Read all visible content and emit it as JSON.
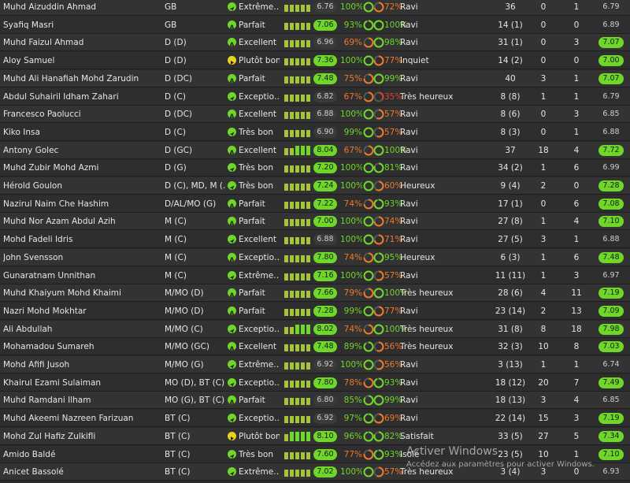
{
  "colors": {
    "good_green": "#6fd62a",
    "form_yellow": "#e6d21f",
    "ring_orange": "#f0782a",
    "ring_red": "#e04030",
    "muted_badge": "#3a3a3a"
  },
  "players": [
    {
      "name": "Muhd Aizuddin Ahmad",
      "position": "GB",
      "icon": "send-icon",
      "form": "Extrême…",
      "form_bars": [
        3,
        3,
        3,
        3,
        3
      ],
      "rating": "6.76",
      "rating_highlight": false,
      "p1": "100%",
      "ring1": "green",
      "p2": "72%",
      "ring2": "orange",
      "morale": "Ravi",
      "apps": "36",
      "goals": "0",
      "assists": "1",
      "avg": "6.79",
      "avg_highlight": false
    },
    {
      "name": "Syafiq Masri",
      "position": "GB",
      "icon": "a-badge-icon",
      "form": "Parfait",
      "form_bars": [
        3,
        3,
        3,
        3,
        3
      ],
      "rating": "7.06",
      "rating_highlight": true,
      "p1": "93%",
      "ring1": "green",
      "p2": "100%",
      "ring2": "green",
      "morale": "Ravi",
      "apps": "14 (1)",
      "goals": "0",
      "assists": "0",
      "avg": "6.89",
      "avg_highlight": false
    },
    {
      "name": "Muhd Faizul Ahmad",
      "position": "D (D)",
      "icon": "a-badge-icon",
      "form": "Excellent",
      "form_bars": [
        3,
        3,
        3,
        3,
        3
      ],
      "rating": "6.96",
      "rating_highlight": false,
      "p1": "69%",
      "ring1": "orange",
      "p2": "98%",
      "ring2": "green",
      "morale": "Ravi",
      "apps": "31 (1)",
      "goals": "0",
      "assists": "3",
      "avg": "7.07",
      "avg_highlight": true
    },
    {
      "name": "Aloy Samuel",
      "position": "D (D)",
      "icon": "play-icon",
      "form": "Plutôt bon",
      "form_bars": [
        3,
        3,
        3,
        3,
        3
      ],
      "rating": "7.36",
      "rating_highlight": true,
      "p1": "100%",
      "ring1": "green",
      "p2": "77%",
      "ring2": "orange",
      "morale": "Inquiet",
      "apps": "14 (2)",
      "goals": "0",
      "assists": "0",
      "avg": "7.00",
      "avg_highlight": true
    },
    {
      "name": "Muhd Ali Hanafiah Mohd Zarudin",
      "position": "D (DC)",
      "icon": "a-badge-icon",
      "form": "Parfait",
      "form_bars": [
        3,
        3,
        3,
        3,
        3
      ],
      "rating": "7.48",
      "rating_highlight": true,
      "p1": "75%",
      "ring1": "orange",
      "p2": "99%",
      "ring2": "green",
      "morale": "Ravi",
      "apps": "40",
      "goals": "3",
      "assists": "1",
      "avg": "7.07",
      "avg_highlight": true
    },
    {
      "name": "Abdul Suhairil Idham Zahari",
      "position": "D (C)",
      "icon": "send-icon",
      "form": "Exceptio…",
      "form_bars": [
        3,
        3,
        3,
        3,
        3
      ],
      "rating": "6.82",
      "rating_highlight": false,
      "p1": "67%",
      "ring1": "orange",
      "p2": "35%",
      "ring2": "red",
      "morale": "Très heureux",
      "apps": "8 (8)",
      "goals": "1",
      "assists": "1",
      "avg": "6.79",
      "avg_highlight": false
    },
    {
      "name": "Francesco Paolucci",
      "position": "D (DC)",
      "icon": "a-badge-icon",
      "form": "Excellent",
      "form_bars": [
        3,
        3,
        3,
        3,
        3
      ],
      "rating": "6.88",
      "rating_highlight": false,
      "p1": "100%",
      "ring1": "green",
      "p2": "57%",
      "ring2": "orange",
      "morale": "Ravi",
      "apps": "8 (6)",
      "goals": "0",
      "assists": "3",
      "avg": "6.85",
      "avg_highlight": false
    },
    {
      "name": "Kiko Insa",
      "position": "D (C)",
      "icon": "send-icon",
      "form": "Très bon",
      "form_bars": [
        3,
        3,
        3,
        3,
        3
      ],
      "rating": "6.90",
      "rating_highlight": false,
      "p1": "99%",
      "ring1": "green",
      "p2": "57%",
      "ring2": "orange",
      "morale": "Ravi",
      "apps": "8 (3)",
      "goals": "0",
      "assists": "1",
      "avg": "6.88",
      "avg_highlight": false
    },
    {
      "name": "Antony Golec",
      "position": "D (GC)",
      "icon": "a-badge-icon",
      "form": "Excellent",
      "form_bars": [
        3,
        3,
        4,
        4,
        4
      ],
      "rating": "8.04",
      "rating_highlight": true,
      "p1": "67%",
      "ring1": "orange",
      "p2": "100%",
      "ring2": "green",
      "morale": "Ravi",
      "apps": "37",
      "goals": "18",
      "assists": "4",
      "avg": "7.72",
      "avg_highlight": true
    },
    {
      "name": "Muhd Zubir Mohd Azmi",
      "position": "D (G)",
      "icon": "send-icon",
      "form": "Très bon",
      "form_bars": [
        3,
        3,
        3,
        3,
        3
      ],
      "rating": "7.20",
      "rating_highlight": true,
      "p1": "100%",
      "ring1": "green",
      "p2": "81%",
      "ring2": "green",
      "morale": "Ravi",
      "apps": "34 (2)",
      "goals": "1",
      "assists": "6",
      "avg": "6.99",
      "avg_highlight": false
    },
    {
      "name": "Hérold Goulon",
      "position": "D (C), MD, M (…",
      "icon": "send-icon",
      "form": "Très bon",
      "form_bars": [
        3,
        3,
        3,
        3,
        3
      ],
      "rating": "7.24",
      "rating_highlight": true,
      "p1": "100%",
      "ring1": "green",
      "p2": "60%",
      "ring2": "orange",
      "morale": "Heureux",
      "apps": "9 (4)",
      "goals": "2",
      "assists": "0",
      "avg": "7.28",
      "avg_highlight": true
    },
    {
      "name": "Nazirul Naim Che Hashim",
      "position": "D/AL/MO (G)",
      "icon": "a-badge-icon",
      "form": "Parfait",
      "form_bars": [
        3,
        3,
        3,
        3,
        3
      ],
      "rating": "7.22",
      "rating_highlight": true,
      "p1": "74%",
      "ring1": "orange",
      "p2": "93%",
      "ring2": "green",
      "morale": "Ravi",
      "apps": "17 (1)",
      "goals": "0",
      "assists": "6",
      "avg": "7.08",
      "avg_highlight": true
    },
    {
      "name": "Muhd Nor Azam Abdul Azih",
      "position": "M (C)",
      "icon": "a-badge-icon",
      "form": "Parfait",
      "form_bars": [
        3,
        3,
        3,
        3,
        3
      ],
      "rating": "7.00",
      "rating_highlight": true,
      "p1": "100%",
      "ring1": "green",
      "p2": "74%",
      "ring2": "orange",
      "morale": "Ravi",
      "apps": "27 (8)",
      "goals": "1",
      "assists": "4",
      "avg": "7.10",
      "avg_highlight": true
    },
    {
      "name": "Mohd Fadeli Idris",
      "position": "M (C)",
      "icon": "send-icon",
      "form": "Excellent",
      "form_bars": [
        3,
        3,
        3,
        3,
        3
      ],
      "rating": "6.88",
      "rating_highlight": false,
      "p1": "100%",
      "ring1": "green",
      "p2": "71%",
      "ring2": "orange",
      "morale": "Ravi",
      "apps": "27 (5)",
      "goals": "3",
      "assists": "1",
      "avg": "6.88",
      "avg_highlight": false
    },
    {
      "name": "John Svensson",
      "position": "M (C)",
      "icon": "a-badge-icon",
      "form": "Exceptio…",
      "form_bars": [
        3,
        3,
        3,
        3,
        3
      ],
      "rating": "7.80",
      "rating_highlight": true,
      "p1": "74%",
      "ring1": "orange",
      "p2": "95%",
      "ring2": "green",
      "morale": "Heureux",
      "apps": "6 (3)",
      "goals": "1",
      "assists": "6",
      "avg": "7.48",
      "avg_highlight": true
    },
    {
      "name": "Gunaratnam Unnithan",
      "position": "M (C)",
      "icon": "send-icon",
      "form": "Extrême…",
      "form_bars": [
        3,
        3,
        3,
        3,
        3
      ],
      "rating": "7.16",
      "rating_highlight": true,
      "p1": "100%",
      "ring1": "green",
      "p2": "57%",
      "ring2": "orange",
      "morale": "Ravi",
      "apps": "11 (11)",
      "goals": "1",
      "assists": "3",
      "avg": "6.97",
      "avg_highlight": false
    },
    {
      "name": "Muhd Khaiyum Mohd Khaimi",
      "position": "M/MO (D)",
      "icon": "a-badge-icon",
      "form": "Parfait",
      "form_bars": [
        3,
        3,
        3,
        3,
        3
      ],
      "rating": "7.66",
      "rating_highlight": true,
      "p1": "79%",
      "ring1": "orange",
      "p2": "100%",
      "ring2": "green",
      "morale": "Très heureux",
      "apps": "28 (6)",
      "goals": "4",
      "assists": "11",
      "avg": "7.19",
      "avg_highlight": true
    },
    {
      "name": "Nazri Mohd Mokhtar",
      "position": "M/MO (D)",
      "icon": "a-badge-icon",
      "form": "Parfait",
      "form_bars": [
        3,
        3,
        3,
        3,
        3
      ],
      "rating": "7.28",
      "rating_highlight": true,
      "p1": "99%",
      "ring1": "green",
      "p2": "77%",
      "ring2": "orange",
      "morale": "Ravi",
      "apps": "23 (14)",
      "goals": "2",
      "assists": "13",
      "avg": "7.09",
      "avg_highlight": true
    },
    {
      "name": "Ali Abdullah",
      "position": "M/MO (C)",
      "icon": "send-icon",
      "form": "Exceptio…",
      "form_bars": [
        3,
        3,
        4,
        4,
        4
      ],
      "rating": "8.02",
      "rating_highlight": true,
      "p1": "74%",
      "ring1": "orange",
      "p2": "100%",
      "ring2": "green",
      "morale": "Très heureux",
      "apps": "31 (8)",
      "goals": "8",
      "assists": "18",
      "avg": "7.98",
      "avg_highlight": true
    },
    {
      "name": "Mohamadou Sumareh",
      "position": "M/MO (GC)",
      "icon": "a-badge-icon",
      "form": "Excellent",
      "form_bars": [
        3,
        3,
        3,
        3,
        3
      ],
      "rating": "7.48",
      "rating_highlight": true,
      "p1": "89%",
      "ring1": "green",
      "p2": "56%",
      "ring2": "orange",
      "morale": "Très heureux",
      "apps": "32 (3)",
      "goals": "10",
      "assists": "8",
      "avg": "7.03",
      "avg_highlight": true
    },
    {
      "name": "Mohd Afifi Jusoh",
      "position": "M/MO (G)",
      "icon": "send-icon",
      "form": "Extrême…",
      "form_bars": [
        3,
        3,
        3,
        3,
        3
      ],
      "rating": "6.92",
      "rating_highlight": false,
      "p1": "100%",
      "ring1": "green",
      "p2": "56%",
      "ring2": "orange",
      "morale": "Ravi",
      "apps": "3 (13)",
      "goals": "1",
      "assists": "1",
      "avg": "6.74",
      "avg_highlight": false
    },
    {
      "name": "Khairul Ezami Sulaiman",
      "position": "MO (D), BT (C)",
      "icon": "send-icon",
      "form": "Exceptio…",
      "form_bars": [
        3,
        3,
        3,
        3,
        3
      ],
      "rating": "7.80",
      "rating_highlight": true,
      "p1": "78%",
      "ring1": "orange",
      "p2": "93%",
      "ring2": "green",
      "morale": "Ravi",
      "apps": "18 (12)",
      "goals": "20",
      "assists": "7",
      "avg": "7.49",
      "avg_highlight": true
    },
    {
      "name": "Muhd Ramdani Ilham",
      "position": "MO (G), BT (C)",
      "icon": "a-badge-icon",
      "form": "Parfait",
      "form_bars": [
        3,
        3,
        3,
        3,
        3
      ],
      "rating": "6.80",
      "rating_highlight": false,
      "p1": "85%",
      "ring1": "green",
      "p2": "99%",
      "ring2": "green",
      "morale": "Ravi",
      "apps": "18 (13)",
      "goals": "3",
      "assists": "4",
      "avg": "6.85",
      "avg_highlight": false
    },
    {
      "name": "Muhd Akeemi Nazreen Farizuan",
      "position": "BT (C)",
      "icon": "send-icon",
      "form": "Exceptio…",
      "form_bars": [
        3,
        3,
        3,
        3,
        3
      ],
      "rating": "6.92",
      "rating_highlight": false,
      "p1": "97%",
      "ring1": "green",
      "p2": "69%",
      "ring2": "orange",
      "morale": "Ravi",
      "apps": "22 (14)",
      "goals": "15",
      "assists": "3",
      "avg": "7.19",
      "avg_highlight": true
    },
    {
      "name": "Mohd Zul Hafiz Zulkifli",
      "position": "BT (C)",
      "icon": "play-icon",
      "form": "Plutôt bon",
      "form_bars": [
        3,
        4,
        4,
        4,
        4
      ],
      "rating": "8.10",
      "rating_highlight": true,
      "p1": "96%",
      "ring1": "green",
      "p2": "82%",
      "ring2": "green",
      "morale": "Satisfait",
      "apps": "33 (5)",
      "goals": "27",
      "assists": "5",
      "avg": "7.34",
      "avg_highlight": true
    },
    {
      "name": "Amido Baldé",
      "position": "BT (C)",
      "icon": "send-icon",
      "form": "Très bon",
      "form_bars": [
        3,
        3,
        3,
        3,
        3
      ],
      "rating": "7.60",
      "rating_highlight": true,
      "p1": "77%",
      "ring1": "orange",
      "p2": "93%",
      "ring2": "green",
      "morale": "Isolé",
      "apps": "23 (5)",
      "goals": "10",
      "assists": "1",
      "avg": "7.10",
      "avg_highlight": true
    },
    {
      "name": "Anicet Bassolé",
      "position": "BT (C)",
      "icon": "send-icon",
      "form": "Extrême…",
      "form_bars": [
        3,
        3,
        3,
        3,
        3
      ],
      "rating": "7.02",
      "rating_highlight": true,
      "p1": "100%",
      "ring1": "green",
      "p2": "57%",
      "ring2": "orange",
      "morale": "Très heureux",
      "apps": "3 (4)",
      "goals": "3",
      "assists": "0",
      "avg": "6.93",
      "avg_highlight": false
    }
  ],
  "watermark": {
    "title": "Activer Windows",
    "subtitle": "Accédez aux paramètres pour activer Windows."
  }
}
